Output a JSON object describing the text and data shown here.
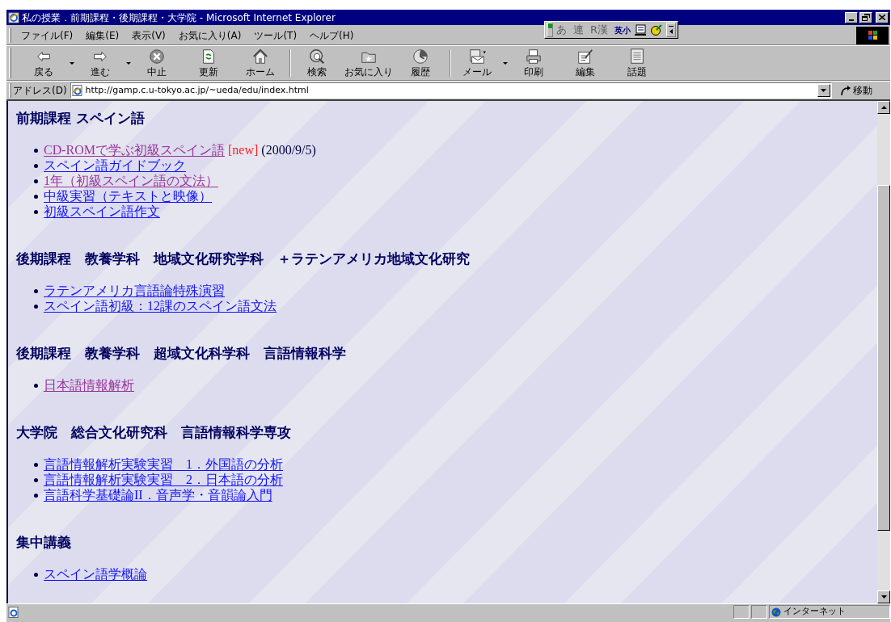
{
  "window": {
    "title": "私の授業．前期課程・後期課程・大学院 - Microsoft Internet Explorer"
  },
  "menu": [
    "ファイル(F)",
    "編集(E)",
    "表示(V)",
    "お気に入り(A)",
    "ツール(T)",
    "ヘルプ(H)"
  ],
  "ime_toolbar": {
    "items": [
      "あ",
      "連",
      "R漢",
      "英小"
    ]
  },
  "toolbar": [
    {
      "label": "戻る",
      "kind": "back",
      "dropdown": true
    },
    {
      "label": "進む",
      "kind": "forward",
      "dropdown": true
    },
    {
      "label": "中止",
      "kind": "stop",
      "dropdown": false
    },
    {
      "label": "更新",
      "kind": "refresh",
      "dropdown": false
    },
    {
      "label": "ホーム",
      "kind": "home",
      "dropdown": false
    },
    {
      "label": "検索",
      "kind": "search",
      "dropdown": false
    },
    {
      "label": "お気に入り",
      "kind": "favorites",
      "dropdown": false
    },
    {
      "label": "履歴",
      "kind": "history",
      "dropdown": false
    },
    {
      "label": "メール",
      "kind": "mail",
      "dropdown": true
    },
    {
      "label": "印刷",
      "kind": "print",
      "dropdown": false
    },
    {
      "label": "編集",
      "kind": "edit",
      "dropdown": false
    },
    {
      "label": "話題",
      "kind": "discuss",
      "dropdown": false
    }
  ],
  "address_bar": {
    "label": "アドレス(D)",
    "url": "http://gamp.c.u-tokyo.ac.jp/~ueda/edu/index.html",
    "go_button": "移動"
  },
  "content": {
    "sections": [
      {
        "heading": "前期課程 スペイン語",
        "links": [
          {
            "text": "CD-ROMで学ぶ初級スペイン語",
            "visited": true,
            "badge": "[new]",
            "note": "(2000/9/5)"
          },
          {
            "text": "スペイン語ガイドブック",
            "visited": false
          },
          {
            "text": "1年（初級スペイン語の文法）",
            "visited": true
          },
          {
            "text": "中級実習（テキストと映像）",
            "visited": false
          },
          {
            "text": "初級スペイン語作文",
            "visited": false
          }
        ]
      },
      {
        "heading": "後期課程　教養学科　地域文化研究学科　＋ラテンアメリカ地域文化研究",
        "links": [
          {
            "text": "ラテンアメリカ言語論特殊演習",
            "visited": false
          },
          {
            "text": "スペイン語初級：12課のスペイン語文法",
            "visited": false
          }
        ]
      },
      {
        "heading": "後期課程　教養学科　超域文化科学科　言語情報科学",
        "links": [
          {
            "text": "日本語情報解析",
            "visited": true
          }
        ]
      },
      {
        "heading": "大学院　総合文化研究科　言語情報科学専攻",
        "links": [
          {
            "text": "言語情報解析実験実習　1．外国語の分析",
            "visited": false
          },
          {
            "text": "言語情報解析実験実習　2．日本語の分析",
            "visited": false
          },
          {
            "text": "言語科学基礎論II．音声学・音韻論入門",
            "visited": false
          }
        ]
      },
      {
        "heading": "集中講義",
        "links": [
          {
            "text": "スペイン語学概論",
            "visited": false
          }
        ]
      }
    ]
  },
  "status_bar": {
    "zone": "インターネット"
  }
}
